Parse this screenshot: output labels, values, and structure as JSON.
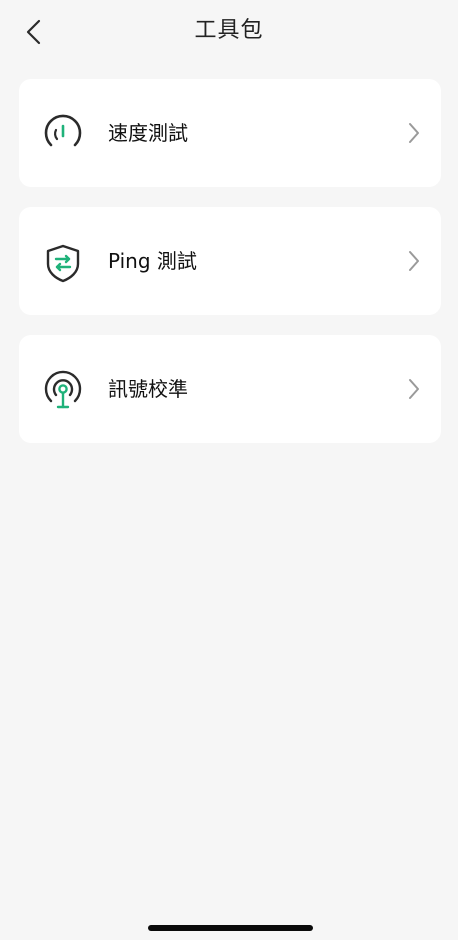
{
  "header": {
    "title": "工具包",
    "back_icon": "chevron-left-icon"
  },
  "items": [
    {
      "label": "速度測試",
      "icon": "speedometer-icon"
    },
    {
      "label": "Ping 測試",
      "icon": "shield-exchange-icon"
    },
    {
      "label": "訊號校準",
      "icon": "signal-antenna-icon"
    }
  ],
  "colors": {
    "background": "#f6f6f6",
    "card": "#ffffff",
    "accent": "#1fb27a",
    "icon_stroke": "#2b2b2b",
    "chevron": "#9a9a9a"
  }
}
